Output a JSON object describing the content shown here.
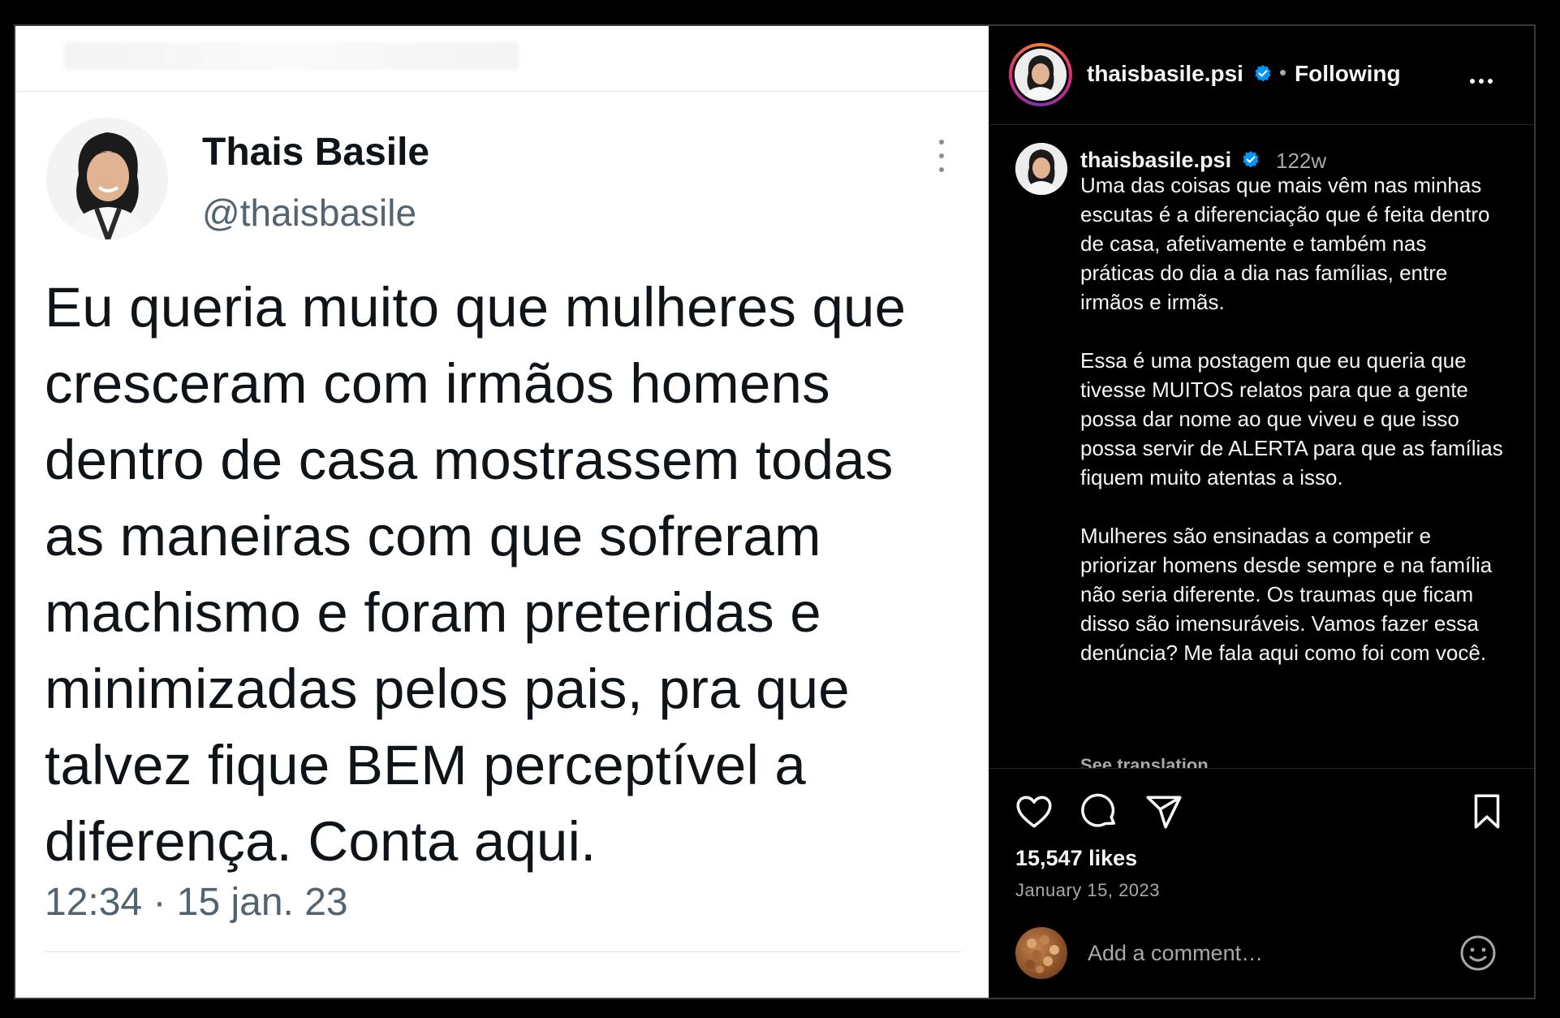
{
  "tweet": {
    "name": "Thais Basile",
    "handle": "@thaisbasile",
    "text_lines": [
      "Eu queria muito que mulheres que",
      "cresceram com irmãos homens",
      "dentro de casa mostrassem todas",
      "as maneiras com que sofreram",
      "machismo e foram preteridas e",
      "minimizadas pelos pais, pra que",
      "talvez fique BEM perceptível a",
      "diferença. Conta aqui."
    ],
    "timestamp": "12:34 · 15 jan. 23"
  },
  "header": {
    "username": "thaisbasile.psi",
    "separator": "•",
    "follow_status": "Following"
  },
  "caption": {
    "username": "thaisbasile.psi",
    "time_ago": "122w",
    "paragraphs": [
      "Uma das coisas que mais vêm nas minhas escutas é a diferenciação que é feita dentro de casa, afetivamente e também nas práticas do dia a dia nas famílias, entre irmãos e irmãs.",
      "Essa é uma postagem que eu queria que tivesse MUITOS relatos para que a gente possa dar nome ao que viveu e que isso possa servir de ALERTA para que as famílias fiquem muito atentas a isso.",
      "Mulheres são ensinadas a competir e priorizar homens desde sempre e na família não seria diferente. Os traumas que ficam disso são imensuráveis. Vamos fazer essa denúncia? Me fala aqui como foi com você."
    ],
    "see_translation": "See translation"
  },
  "stats": {
    "likes": "15,547 likes",
    "date": "January 15, 2023"
  },
  "comment": {
    "placeholder": "Add a comment…"
  },
  "colors": {
    "verified": "#0095f6",
    "muted": "#a8a8a8",
    "tweet_text": "#0f1419",
    "tweet_muted": "#536471"
  },
  "icons": [
    "more-icon",
    "verified-icon",
    "heart-icon",
    "comment-icon",
    "share-icon",
    "bookmark-icon",
    "emoji-icon"
  ]
}
